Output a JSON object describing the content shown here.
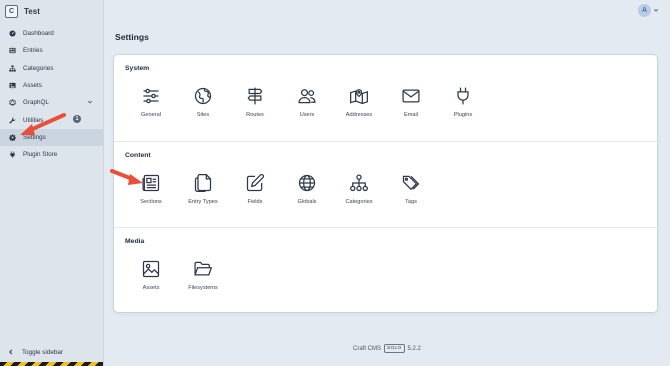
{
  "site": {
    "initial": "C",
    "name": "Test"
  },
  "nav": {
    "items": [
      {
        "label": "Dashboard",
        "icon": "gauge-icon"
      },
      {
        "label": "Entries",
        "icon": "newspaper-icon"
      },
      {
        "label": "Categories",
        "icon": "sitemap-icon"
      },
      {
        "label": "Assets",
        "icon": "image-icon"
      },
      {
        "label": "GraphQL",
        "icon": "graphql-icon"
      },
      {
        "label": "Utilities",
        "icon": "wrench-icon",
        "badge": "1"
      },
      {
        "label": "Settings",
        "icon": "gear-icon",
        "active": true
      },
      {
        "label": "Plugin Store",
        "icon": "plug-icon"
      }
    ],
    "toggle_label": "Toggle sidebar"
  },
  "user": {
    "initial": "A"
  },
  "page": {
    "title": "Settings"
  },
  "sections": [
    {
      "title": "System",
      "items": [
        {
          "label": "General",
          "icon": "sliders-icon"
        },
        {
          "label": "Sites",
          "icon": "globe-icon"
        },
        {
          "label": "Routes",
          "icon": "signpost-icon"
        },
        {
          "label": "Users",
          "icon": "users-icon"
        },
        {
          "label": "Addresses",
          "icon": "map-icon"
        },
        {
          "label": "Email",
          "icon": "envelope-icon"
        },
        {
          "label": "Plugins",
          "icon": "plug-icon"
        }
      ]
    },
    {
      "title": "Content",
      "items": [
        {
          "label": "Sections",
          "icon": "newspaper-icon"
        },
        {
          "label": "Entry Types",
          "icon": "files-icon"
        },
        {
          "label": "Fields",
          "icon": "pen-square-icon"
        },
        {
          "label": "Globals",
          "icon": "globe-icon"
        },
        {
          "label": "Categories",
          "icon": "sitemap-icon"
        },
        {
          "label": "Tags",
          "icon": "tags-icon"
        }
      ]
    },
    {
      "title": "Media",
      "items": [
        {
          "label": "Assets",
          "icon": "image-icon"
        },
        {
          "label": "Filesystems",
          "icon": "folder-open-icon"
        }
      ]
    }
  ],
  "footer": {
    "product": "Craft CMS",
    "edition": "SOLO",
    "version": "5.2.2"
  },
  "colors": {
    "accent_arrow": "#e8503a",
    "background": "#e4eaf1",
    "sidebar": "#dde4ec"
  }
}
